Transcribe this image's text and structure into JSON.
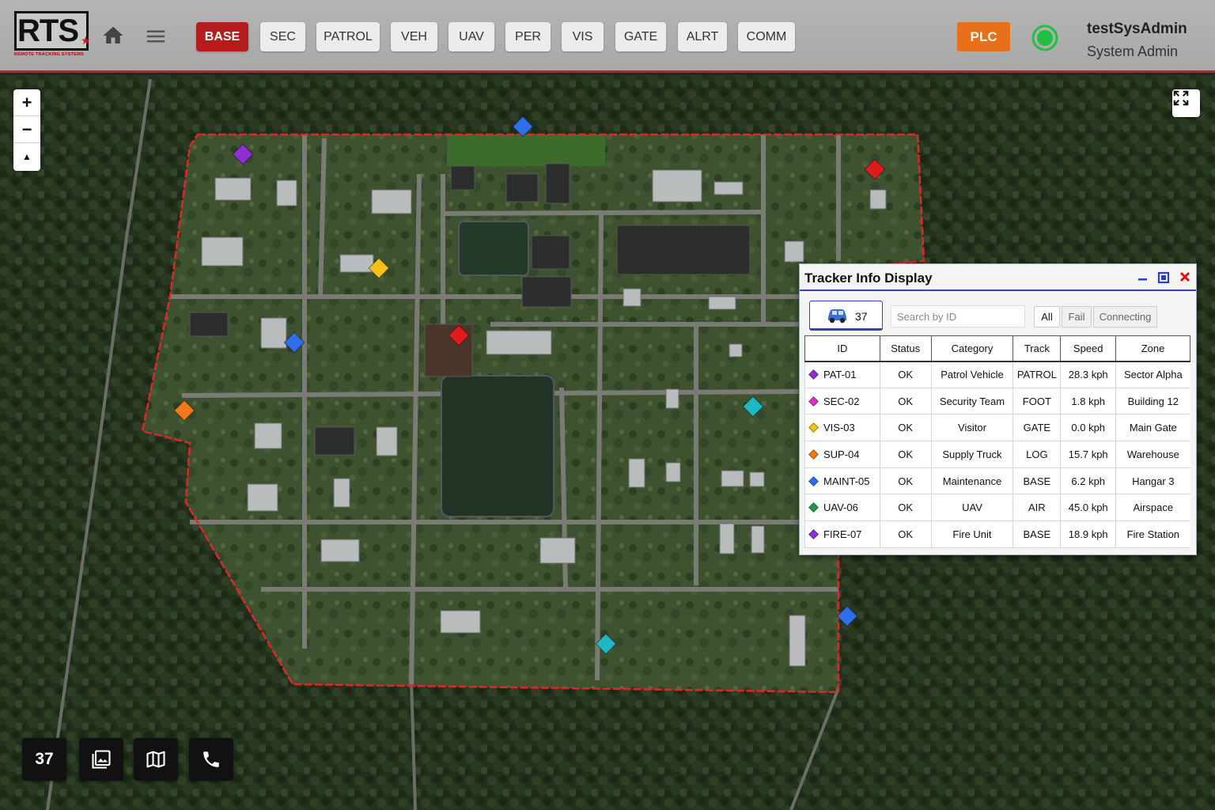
{
  "header": {
    "logo": {
      "text": "RTS",
      "subtitle": "REMOTE TRACKING SYSTEMS"
    },
    "nav": [
      {
        "label": "BASE",
        "active": true
      },
      {
        "label": "SEC",
        "active": false
      },
      {
        "label": "PATROL",
        "active": false
      },
      {
        "label": "VEH",
        "active": false
      },
      {
        "label": "UAV",
        "active": false
      },
      {
        "label": "PER",
        "active": false
      },
      {
        "label": "VIS",
        "active": false
      },
      {
        "label": "GATE",
        "active": false
      },
      {
        "label": "ALRT",
        "active": false
      },
      {
        "label": "COMM",
        "active": false
      }
    ],
    "plc_label": "PLC",
    "status": "online",
    "user": {
      "name": "testSysAdmin",
      "role": "System Admin"
    }
  },
  "map": {
    "zoom_in": "+",
    "zoom_out": "−",
    "compass": "▲",
    "markers": [
      {
        "color": "#2f6fe8"
      },
      {
        "color": "#8e2fd4"
      },
      {
        "color": "#e01b1b"
      },
      {
        "color": "#f2c21a"
      },
      {
        "color": "#2f6fe8"
      },
      {
        "color": "#e01b1b"
      },
      {
        "color": "#f07a1a"
      },
      {
        "color": "#1fb7c1"
      },
      {
        "color": "#2f6fe8"
      },
      {
        "color": "#1fb7c1"
      }
    ]
  },
  "bottom_bar": {
    "count": "37",
    "icons": [
      "layers-icon",
      "map-icon",
      "phone-icon"
    ]
  },
  "tracker": {
    "title": "Tracker Info Display",
    "vehicle_count": "37",
    "search_placeholder": "Search by ID",
    "filters": [
      {
        "label": "All",
        "active": true
      },
      {
        "label": "Fail",
        "active": false
      },
      {
        "label": "Connecting",
        "active": false
      }
    ],
    "columns": [
      "ID",
      "Status",
      "Category",
      "Track",
      "Speed",
      "Zone"
    ],
    "rows": [
      {
        "color": "#8e2fd4",
        "id": "PAT-01",
        "status": "OK",
        "category": "Patrol Vehicle",
        "track": "PATROL",
        "speed": "28.3 kph",
        "zone": "Sector Alpha"
      },
      {
        "color": "#e02fd0",
        "id": "SEC-02",
        "status": "OK",
        "category": "Security Team",
        "track": "FOOT",
        "speed": "1.8 kph",
        "zone": "Building 12"
      },
      {
        "color": "#f2c21a",
        "id": "VIS-03",
        "status": "OK",
        "category": "Visitor",
        "track": "GATE",
        "speed": "0.0 kph",
        "zone": "Main Gate"
      },
      {
        "color": "#f07a1a",
        "id": "SUP-04",
        "status": "OK",
        "category": "Supply Truck",
        "track": "LOG",
        "speed": "15.7 kph",
        "zone": "Warehouse"
      },
      {
        "color": "#2f6fe8",
        "id": "MAINT-05",
        "status": "OK",
        "category": "Maintenance",
        "track": "BASE",
        "speed": "6.2 kph",
        "zone": "Hangar 3"
      },
      {
        "color": "#1a9a4a",
        "id": "UAV-06",
        "status": "OK",
        "category": "UAV",
        "track": "AIR",
        "speed": "45.0 kph",
        "zone": "Airspace"
      },
      {
        "color": "#8e2fd4",
        "id": "FIRE-07",
        "status": "OK",
        "category": "Fire Unit",
        "track": "BASE",
        "speed": "18.9 kph",
        "zone": "Fire Station"
      }
    ]
  }
}
